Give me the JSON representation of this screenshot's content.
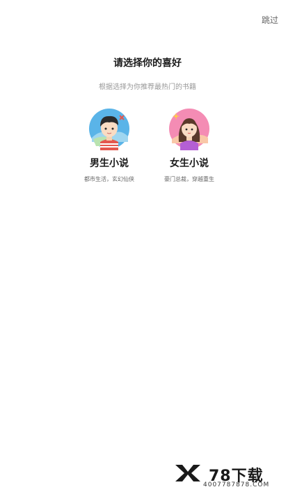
{
  "header": {
    "skip_label": "跳过"
  },
  "main": {
    "title": "请选择你的喜好",
    "subtitle": "根据选择为你推荐最热门的书籍",
    "options": [
      {
        "title": "男生小说",
        "desc": "都市生活，玄幻仙侠",
        "icon": "boy-avatar-icon"
      },
      {
        "title": "女生小说",
        "desc": "豪门总裁，穿越重生",
        "icon": "girl-avatar-icon"
      }
    ]
  },
  "watermark": {
    "name": "78下载",
    "url": "4007787878.COM"
  },
  "colors": {
    "background": "#ffffff",
    "male_circle": "#5ab4e8",
    "female_circle": "#f48cb4"
  }
}
